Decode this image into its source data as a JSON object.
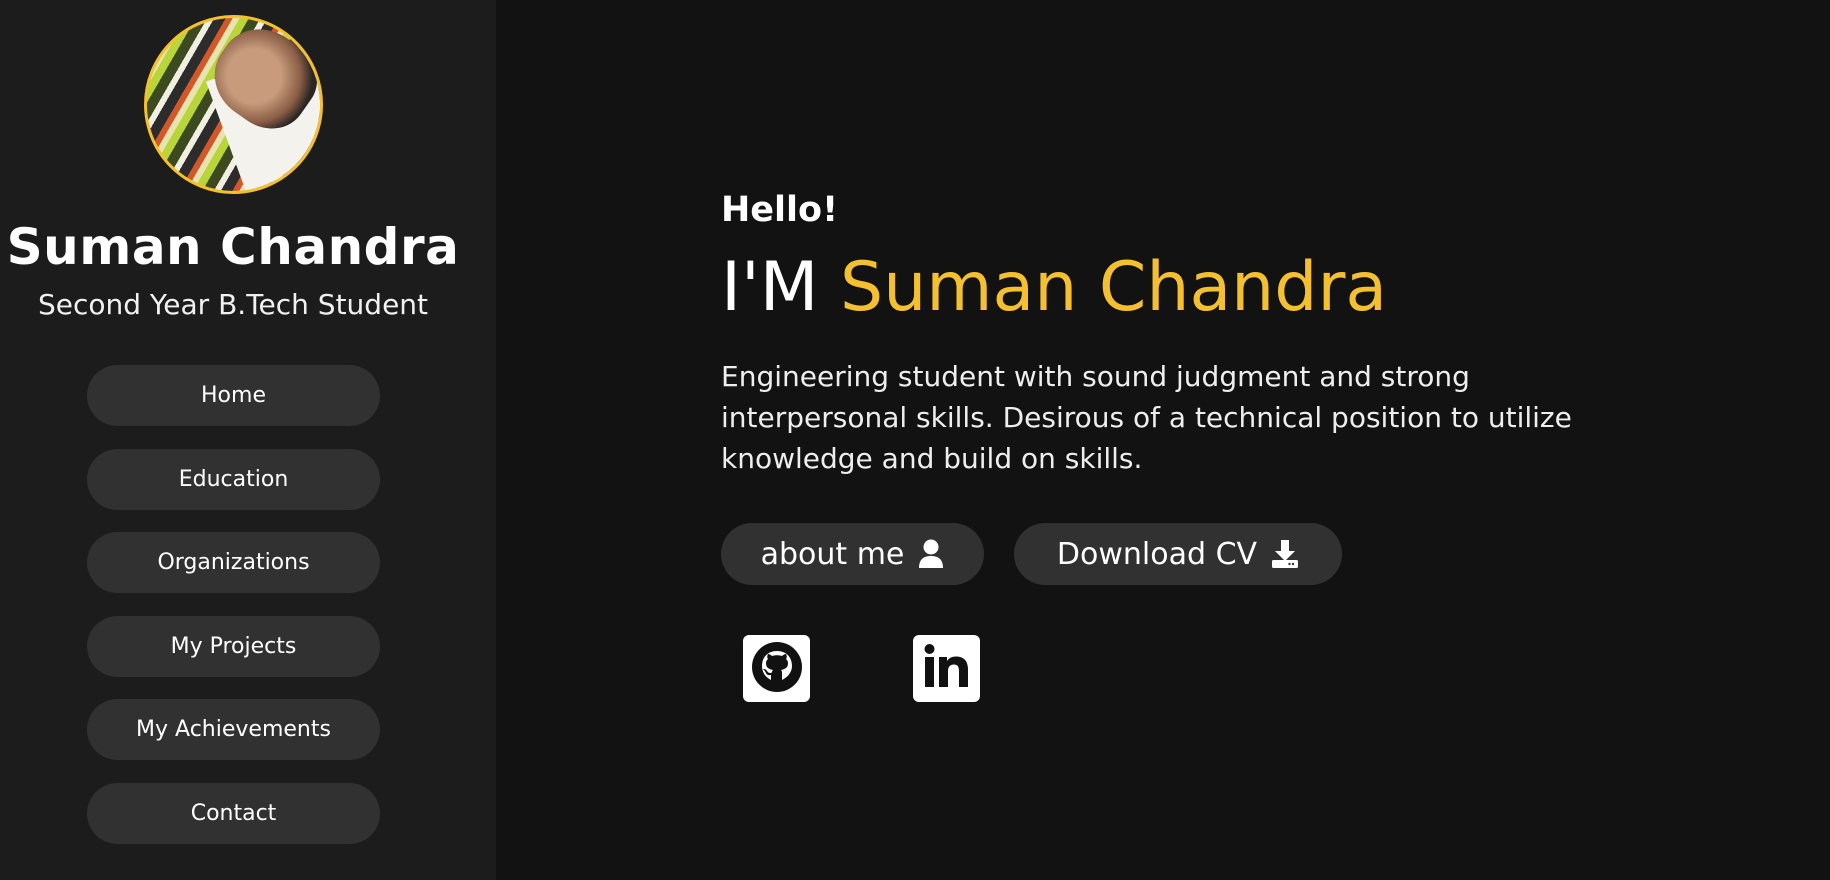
{
  "profile": {
    "name": "Suman Chandra",
    "role": "Second Year B.Tech Student",
    "avatar_alt": "profile photo"
  },
  "nav": {
    "items": [
      {
        "label": "Home"
      },
      {
        "label": "Education"
      },
      {
        "label": "Organizations"
      },
      {
        "label": "My Projects"
      },
      {
        "label": "My Achievements"
      },
      {
        "label": "Contact"
      }
    ]
  },
  "hero": {
    "greeting": "Hello!",
    "prefix": "I'M ",
    "highlight": "Suman Chandra",
    "description": "Engineering student with sound judgment and strong interpersonal skills. Desirous of a technical position to utilize knowledge and build on skills."
  },
  "buttons": {
    "about_label": "about me",
    "about_icon": "user-icon",
    "cv_label": "Download CV",
    "cv_icon": "download-icon"
  },
  "social": [
    {
      "icon": "github-icon"
    },
    {
      "icon": "linkedin-icon"
    }
  ],
  "colors": {
    "accent": "#f5c030",
    "sidebar_bg": "#1c1c1c",
    "main_bg": "#121212",
    "button_bg": "#313131",
    "text": "#ffffff"
  }
}
